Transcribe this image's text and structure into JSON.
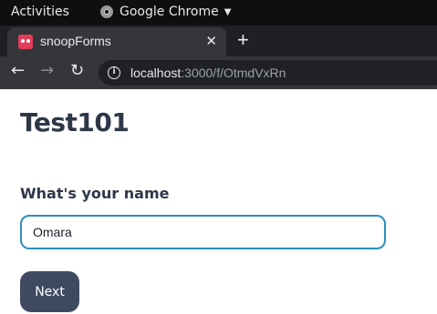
{
  "topbar": {
    "activities_label": "Activities",
    "app_label": "Google Chrome",
    "app_icon": "chrome-icon"
  },
  "browser": {
    "tab": {
      "title": "snoopForms",
      "favicon": "snoopforms-favicon",
      "close_glyph": "✕"
    },
    "new_tab_glyph": "+",
    "nav": {
      "back_glyph": "←",
      "forward_glyph": "→",
      "reload_glyph": "↻"
    },
    "url": {
      "host": "localhost",
      "path": ":3000/f/OtmdVxRn"
    }
  },
  "form": {
    "title": "Test101",
    "question": "What's your name",
    "answer_value": "Omara",
    "next_label": "Next"
  },
  "colors": {
    "accent": "#2b8fbf",
    "button": "#3f4a61",
    "heading": "#2d3748"
  }
}
